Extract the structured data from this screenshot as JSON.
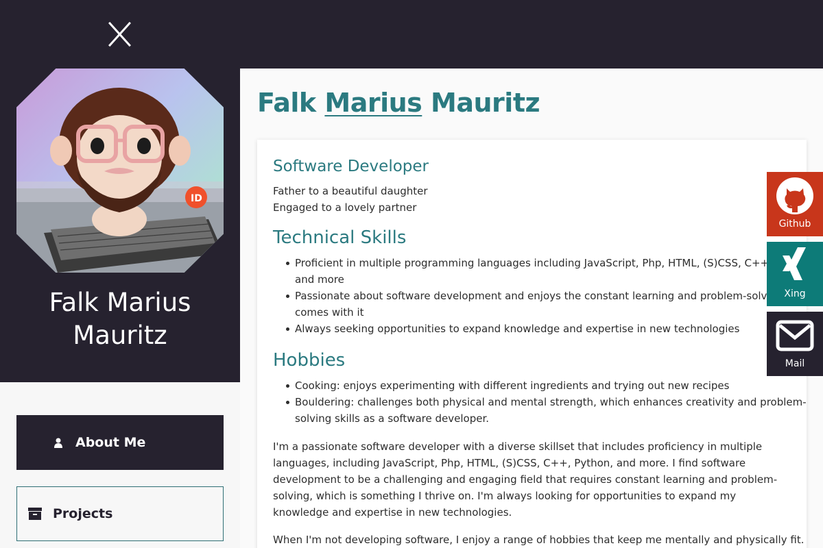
{
  "header": {
    "close_icon": "close-icon"
  },
  "profile": {
    "name_line1": "Falk Marius",
    "name_line2": "Mauritz",
    "avatar_icon": "avatar"
  },
  "nav": {
    "about_label": "About Me",
    "about_icon": "user-icon",
    "projects_label": "Projects",
    "projects_icon": "archive-icon"
  },
  "main": {
    "title_first": "Falk",
    "title_middle": "Marius",
    "title_last": "Mauritz",
    "job_title": "Software Developer",
    "lines": [
      "Father to a beautiful daughter",
      "Engaged to a lovely partner"
    ],
    "skills_heading": "Technical Skills",
    "skills": [
      "Proficient in multiple programming languages including JavaScript, Php, HTML, (S)CSS, C++, Python,",
      "and more",
      "Passionate about software development and enjoys the constant learning and problem-solving that",
      "comes with it",
      "Always seeking opportunities to expand knowledge and expertise in new technologies"
    ],
    "hobbies_heading": "Hobbies",
    "hobbies": [
      "Cooking: enjoys experimenting with different ingredients and trying out new recipes",
      "Bouldering: challenges both physical and mental strength, which enhances creativity and problem-",
      "solving skills as a software developer."
    ],
    "paragraph1": "I'm a passionate software developer with a diverse skillset that includes proficiency in multiple languages, including JavaScript, Php, HTML, (S)CSS, C++, Python, and more. I find software development to be a challenging and engaging field that requires constant learning and problem-solving, which is something I thrive on. I'm always looking for opportunities to expand my knowledge and expertise in new technologies.",
    "paragraph2": "When I'm not developing software, I enjoy a range of hobbies that keep me mentally and physically fit."
  },
  "social": {
    "github_label": "Github",
    "xing_label": "Xing",
    "mail_label": "Mail",
    "github_color": "#c8361b",
    "xing_color": "#0d7b78",
    "mail_color": "#26222f"
  },
  "colors": {
    "dark": "#26222f",
    "accent": "#2b7a80"
  }
}
